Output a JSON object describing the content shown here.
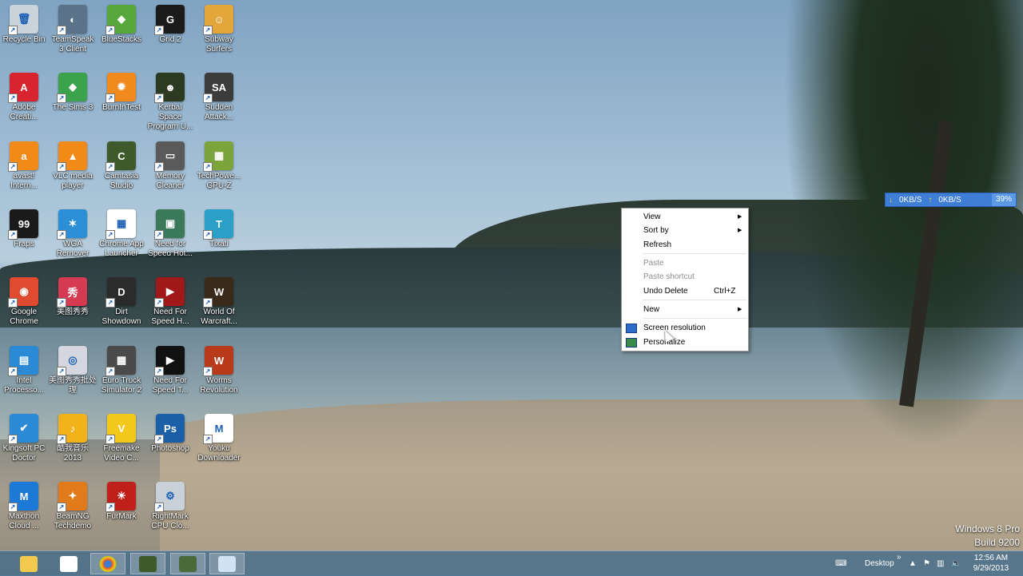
{
  "desktop_icons": [
    {
      "label": "Recycle Bin",
      "color": "#c9d3dc",
      "glyph": "🗑"
    },
    {
      "label": "TeamSpeak 3 Client",
      "color": "#5a7389",
      "glyph": "◐"
    },
    {
      "label": "BlueStacks",
      "color": "#58a73a",
      "glyph": "◆"
    },
    {
      "label": "Grid 2",
      "color": "#1b1b1b",
      "glyph": "G"
    },
    {
      "label": "Subway Surfers",
      "color": "#e2a63a",
      "glyph": "☺"
    },
    {
      "label": "Adobe Creati...",
      "color": "#d7242f",
      "glyph": "A"
    },
    {
      "label": "The Sims 3",
      "color": "#3aa34b",
      "glyph": "◆"
    },
    {
      "label": "BurnInTest",
      "color": "#f08a1e",
      "glyph": "✹"
    },
    {
      "label": "Kerbal Space Program U...",
      "color": "#2b3a20",
      "glyph": "☻"
    },
    {
      "label": "Sudden Attack...",
      "color": "#3c3c3c",
      "glyph": "SA"
    },
    {
      "label": "avast! Intern...",
      "color": "#f28a18",
      "glyph": "a"
    },
    {
      "label": "VLC media player",
      "color": "#f28a18",
      "glyph": "▲"
    },
    {
      "label": "Camtasia Studio",
      "color": "#3f5a2a",
      "glyph": "C"
    },
    {
      "label": "Memory Cleaner",
      "color": "#5a5a5a",
      "glyph": "▭"
    },
    {
      "label": "TechPowe... GPU-Z",
      "color": "#7ba43b",
      "glyph": "▦"
    },
    {
      "label": "Fraps",
      "color": "#1a1a1a",
      "glyph": "99"
    },
    {
      "label": "WGA Remover",
      "color": "#2b8fd6",
      "glyph": "✶"
    },
    {
      "label": "Chrome App Launcher",
      "color": "#ffffff",
      "glyph": "▦"
    },
    {
      "label": "Need for Speed Hot...",
      "color": "#3a7a5a",
      "glyph": "▣"
    },
    {
      "label": "Tixati",
      "color": "#2aa0c8",
      "glyph": "T"
    },
    {
      "label": "Google Chrome",
      "color": "#e04a2f",
      "glyph": "◉"
    },
    {
      "label": "美图秀秀",
      "color": "#d63a52",
      "glyph": "秀"
    },
    {
      "label": "Dirt Showdown",
      "color": "#2b2b2b",
      "glyph": "D"
    },
    {
      "label": "Need For Speed H...",
      "color": "#a01818",
      "glyph": "▶"
    },
    {
      "label": "World Of Warcraft...",
      "color": "#3a2a1a",
      "glyph": "W"
    },
    {
      "label": "Intel Processo...",
      "color": "#2b8ad6",
      "glyph": "▤"
    },
    {
      "label": "美图秀秀批处理",
      "color": "#d6d6e0",
      "glyph": "◎"
    },
    {
      "label": "Euro Truck Simulator 2",
      "color": "#4a4a4a",
      "glyph": "▦"
    },
    {
      "label": "Need For Speed T...",
      "color": "#111111",
      "glyph": "▶"
    },
    {
      "label": "Worms Revolution",
      "color": "#b83a1a",
      "glyph": "W"
    },
    {
      "label": "Kingsoft PC Doctor",
      "color": "#2b8ad6",
      "glyph": "✔"
    },
    {
      "label": "酷我音乐2013",
      "color": "#f2b21a",
      "glyph": "♪"
    },
    {
      "label": "Freemake Video C...",
      "color": "#f2c81a",
      "glyph": "V"
    },
    {
      "label": "Photoshop",
      "color": "#1b5fa8",
      "glyph": "Ps"
    },
    {
      "label": "Youku Downloader",
      "color": "#ffffff",
      "glyph": "M"
    },
    {
      "label": "Maxthon Cloud ...",
      "color": "#1c7ad6",
      "glyph": "M"
    },
    {
      "label": "BeamNG Techdemo",
      "color": "#e07a1a",
      "glyph": "✦"
    },
    {
      "label": "FurMark",
      "color": "#c0201a",
      "glyph": "☀"
    },
    {
      "label": "RightMark CPU Clo...",
      "color": "#c8d0d8",
      "glyph": "⚙"
    }
  ],
  "net_meter": {
    "down": "0KB/S",
    "up": "0KB/S",
    "percent": "39%"
  },
  "context_menu": {
    "view": "View",
    "sort_by": "Sort by",
    "refresh": "Refresh",
    "paste": "Paste",
    "paste_shortcut": "Paste shortcut",
    "undo_delete": "Undo Delete",
    "undo_shortcut": "Ctrl+Z",
    "new": "New",
    "screen_resolution": "Screen resolution",
    "personalize": "Personalize"
  },
  "watermark": {
    "line1": "Windows 8 Pro",
    "line2": "Build 9200"
  },
  "taskbar": {
    "desktop_label": "Desktop",
    "chevron": "»",
    "time": "12:56 AM",
    "date": "9/29/2013"
  }
}
